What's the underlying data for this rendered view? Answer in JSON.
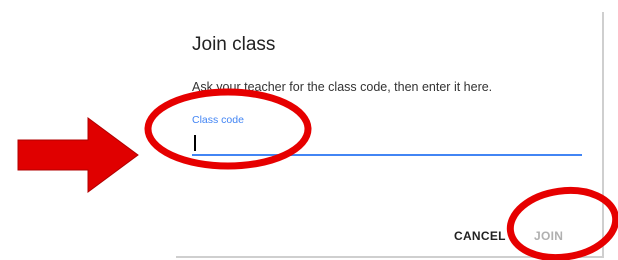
{
  "dialog": {
    "title": "Join class",
    "description": "Ask your teacher for the class code, then enter it here.",
    "field": {
      "label": "Class code",
      "value": ""
    },
    "actions": {
      "cancel_label": "CANCEL",
      "join_label": "JOIN"
    }
  },
  "colors": {
    "accent": "#4285f4",
    "annotation": "#e60000",
    "disabled_text": "#b0b0b0"
  },
  "annotations": {
    "arrow": "right-arrow-icon",
    "circles": [
      "class-code-highlight",
      "join-highlight"
    ]
  }
}
